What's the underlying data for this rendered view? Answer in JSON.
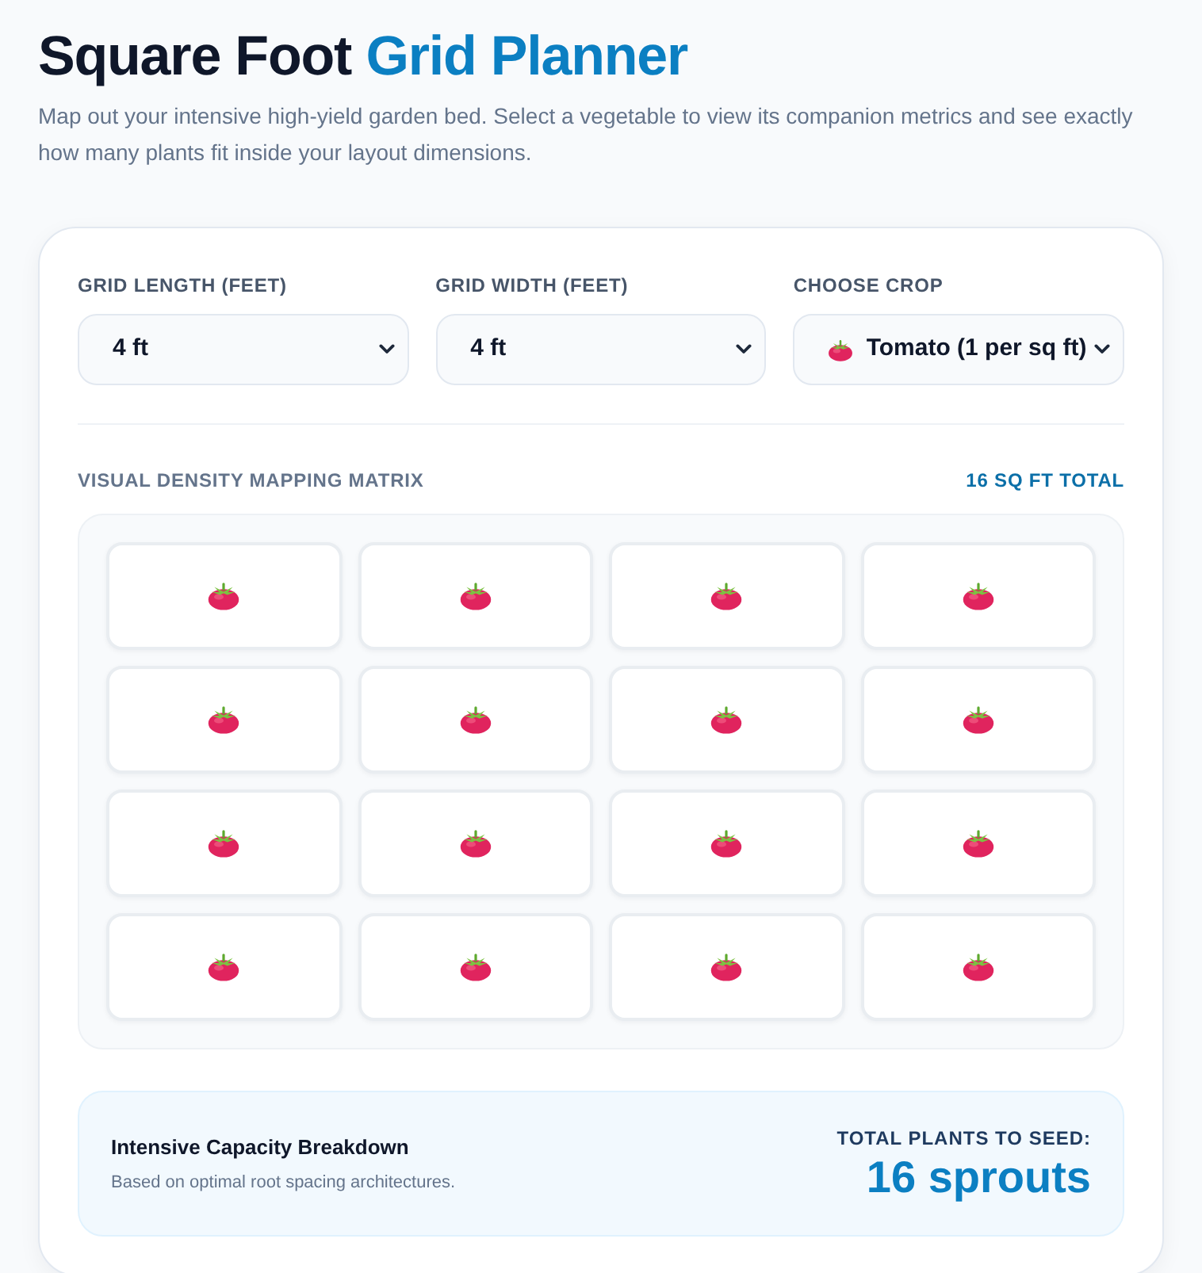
{
  "header": {
    "title": "Square Foot",
    "title_accent": "Grid Planner",
    "subtitle": "Map out your intensive high-yield garden bed. Select a vegetable to view its companion metrics and see exactly how many plants fit inside your layout dimensions."
  },
  "controls": [
    {
      "kind": "size",
      "label": "GRID LENGTH (FEET)",
      "value": "4 ft"
    },
    {
      "kind": "size",
      "label": "GRID WIDTH (FEET)",
      "value": "4 ft"
    },
    {
      "kind": "crop",
      "label": "CHOOSE CROP",
      "value": "Tomato (1 per sq ft)"
    }
  ],
  "matrix": {
    "title": "VISUAL DENSITY MAPPING MATRIX",
    "total": "16 SQ FT TOTAL",
    "rows": [
      [
        {
          "planted": true
        },
        {
          "planted": true
        },
        {
          "planted": true
        },
        {
          "planted": true
        }
      ],
      [
        {
          "planted": true
        },
        {
          "planted": true
        },
        {
          "planted": true
        },
        {
          "planted": true
        }
      ],
      [
        {
          "planted": true
        },
        {
          "planted": true
        },
        {
          "planted": true
        },
        {
          "planted": true
        }
      ],
      [
        {
          "planted": true
        },
        {
          "planted": true
        },
        {
          "planted": true
        },
        {
          "planted": true
        }
      ]
    ]
  },
  "summary": {
    "title": "Intensive Capacity Breakdown",
    "note": "Based on optimal root spacing architectures.",
    "total_label": "TOTAL PLANTS TO SEED:",
    "total_value": "16 sprouts"
  }
}
